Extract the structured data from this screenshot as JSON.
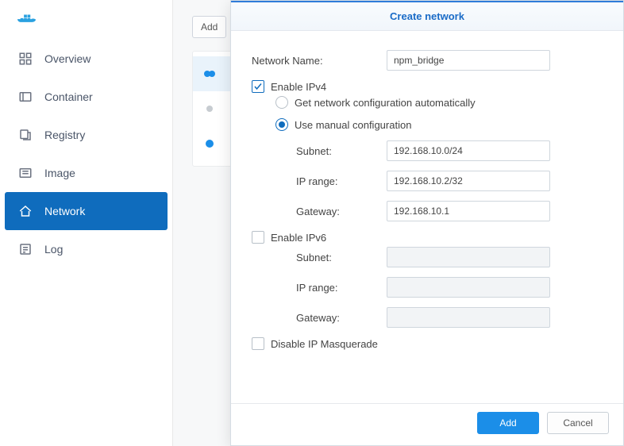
{
  "sidebar": {
    "items": [
      {
        "label": "Overview"
      },
      {
        "label": "Container"
      },
      {
        "label": "Registry"
      },
      {
        "label": "Image"
      },
      {
        "label": "Network"
      },
      {
        "label": "Log"
      }
    ]
  },
  "toolbar": {
    "add_label": "Add"
  },
  "dialog": {
    "title": "Create network",
    "network_name_label": "Network Name:",
    "network_name_value": "npm_bridge",
    "enable_ipv4_label": "Enable IPv4",
    "auto_label": "Get network configuration automatically",
    "manual_label": "Use manual configuration",
    "ipv4": {
      "subnet_label": "Subnet:",
      "subnet_value": "192.168.10.0/24",
      "iprange_label": "IP range:",
      "iprange_value": "192.168.10.2/32",
      "gateway_label": "Gateway:",
      "gateway_value": "192.168.10.1"
    },
    "enable_ipv6_label": "Enable IPv6",
    "ipv6": {
      "subnet_label": "Subnet:",
      "subnet_value": "",
      "iprange_label": "IP range:",
      "iprange_value": "",
      "gateway_label": "Gateway:",
      "gateway_value": ""
    },
    "masq_label": "Disable IP Masquerade",
    "ok_label": "Add",
    "cancel_label": "Cancel"
  }
}
